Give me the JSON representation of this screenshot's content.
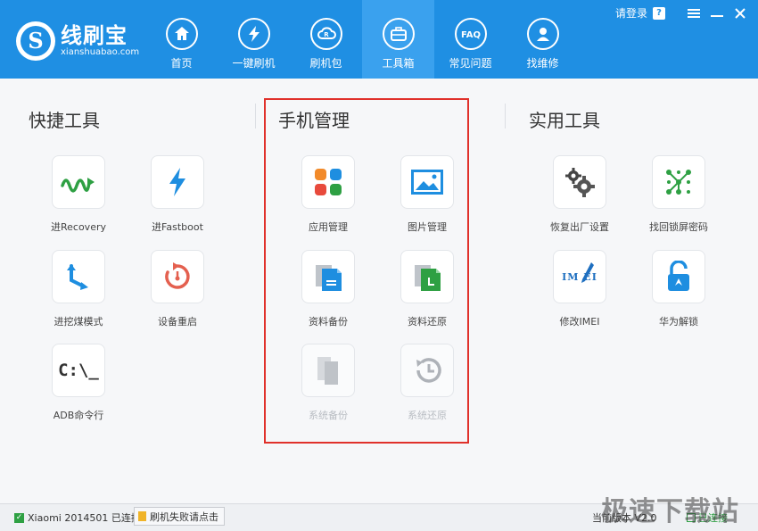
{
  "app": {
    "name": "线刷宝",
    "domain": "xianshuabao.com"
  },
  "nav": [
    {
      "label": "首页",
      "icon": "home-icon"
    },
    {
      "label": "一键刷机",
      "icon": "lightning-icon"
    },
    {
      "label": "刷机包",
      "icon": "package-cloud-icon"
    },
    {
      "label": "工具箱",
      "icon": "toolbox-icon",
      "active": true
    },
    {
      "label": "常见问题",
      "icon": "faq-icon"
    },
    {
      "label": "找维修",
      "icon": "repair-person-icon"
    }
  ],
  "window": {
    "login": "请登录",
    "help": "?"
  },
  "sections": {
    "quick": {
      "title": "快捷工具",
      "tools": [
        {
          "label": "进Recovery",
          "icon": "recovery-icon"
        },
        {
          "label": "进Fastboot",
          "icon": "fastboot-icon"
        },
        {
          "label": "进挖煤模式",
          "icon": "download-mode-icon"
        },
        {
          "label": "设备重启",
          "icon": "restart-icon"
        },
        {
          "label": "ADB命令行",
          "icon": "adb-terminal-icon",
          "glyph": "C:\\_"
        }
      ]
    },
    "phone": {
      "title": "手机管理",
      "tools": [
        {
          "label": "应用管理",
          "icon": "app-grid-icon"
        },
        {
          "label": "图片管理",
          "icon": "image-icon"
        },
        {
          "label": "资料备份",
          "icon": "data-backup-icon"
        },
        {
          "label": "资料还原",
          "icon": "data-restore-icon"
        },
        {
          "label": "系统备份",
          "icon": "system-backup-icon",
          "disabled": true
        },
        {
          "label": "系统还原",
          "icon": "system-restore-icon",
          "disabled": true
        }
      ]
    },
    "util": {
      "title": "实用工具",
      "tools": [
        {
          "label": "恢复出厂设置",
          "icon": "factory-reset-gear-icon"
        },
        {
          "label": "找回锁屏密码",
          "icon": "pattern-lock-icon"
        },
        {
          "label": "修改IMEI",
          "icon": "imei-edit-icon",
          "glyph": "IM EI"
        },
        {
          "label": "华为解锁",
          "icon": "huawei-unlock-icon"
        }
      ]
    }
  },
  "status": {
    "device": "Xiaomi 2014501 已连接",
    "fail_button": "刷机失败请点击",
    "version": "当前版本 V2.0",
    "right": "已连接"
  },
  "watermark": "极速下载站",
  "colors": {
    "header": "#1f8fe3",
    "active_tab": "#3aa1ee",
    "highlight": "#e0312b",
    "status_ok": "#2ea043"
  }
}
